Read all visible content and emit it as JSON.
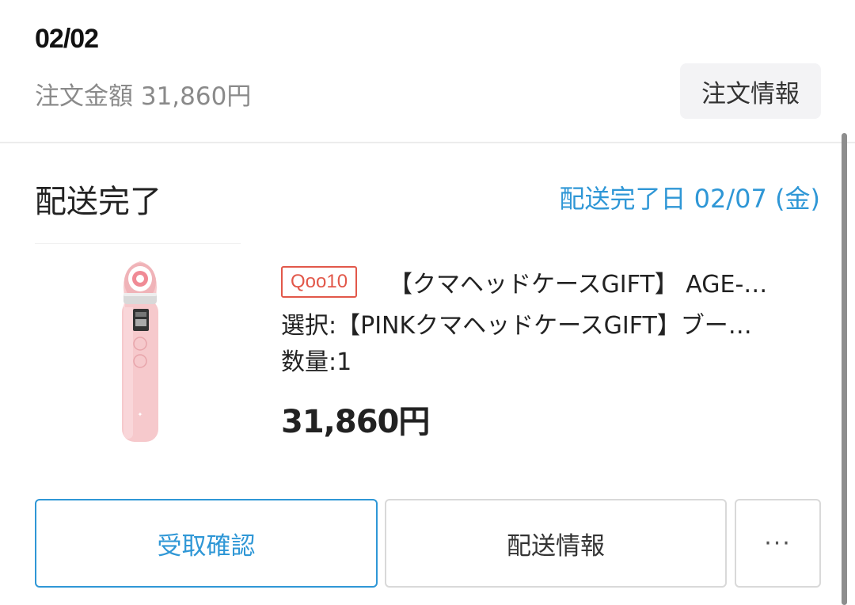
{
  "order": {
    "date": "02/02",
    "amount_text": "注文金額 31,860円",
    "info_button_label": "注文情報"
  },
  "delivery": {
    "status": "配送完了",
    "completed_date_text": "配送完了日 02/07 (金)"
  },
  "product": {
    "shop_badge": "Qoo10",
    "name": "【クマヘッドケースGIFT】 AGE-…",
    "option": "選択:【PINKクマヘッドケースGIFT】ブー…",
    "quantity": "数量:1",
    "price": "31,860円",
    "image_icon": "pink-beauty-device-image"
  },
  "actions": {
    "confirm_receipt": "受取確認",
    "delivery_info": "配送情報",
    "more": "···"
  },
  "colors": {
    "accent": "#2f97d6",
    "badge": "#e2584a",
    "muted_text": "#8a8a8a",
    "product_pink": "#f6c9cc"
  }
}
